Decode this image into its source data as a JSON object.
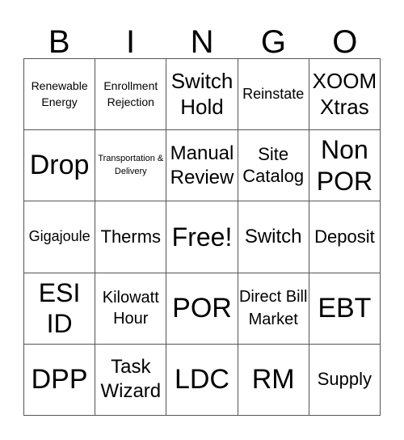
{
  "header": {
    "letters": [
      "B",
      "I",
      "N",
      "G",
      "O"
    ]
  },
  "board": {
    "cells": [
      "Renewable Energy",
      "Enrollment Rejection",
      "Switch Hold",
      "Reinstate",
      "XOOM Xtras",
      "Drop",
      "Transportation & Delivery",
      "Manual Review",
      "Site Catalog",
      "Non POR",
      "Gigajoule",
      "Therms",
      "Free!",
      "Switch",
      "Deposit",
      "ESI ID",
      "Kilowatt Hour",
      "POR",
      "Direct Bill Market",
      "EBT",
      "DPP",
      "Task Wizard",
      "LDC",
      "RM",
      "Supply"
    ]
  }
}
